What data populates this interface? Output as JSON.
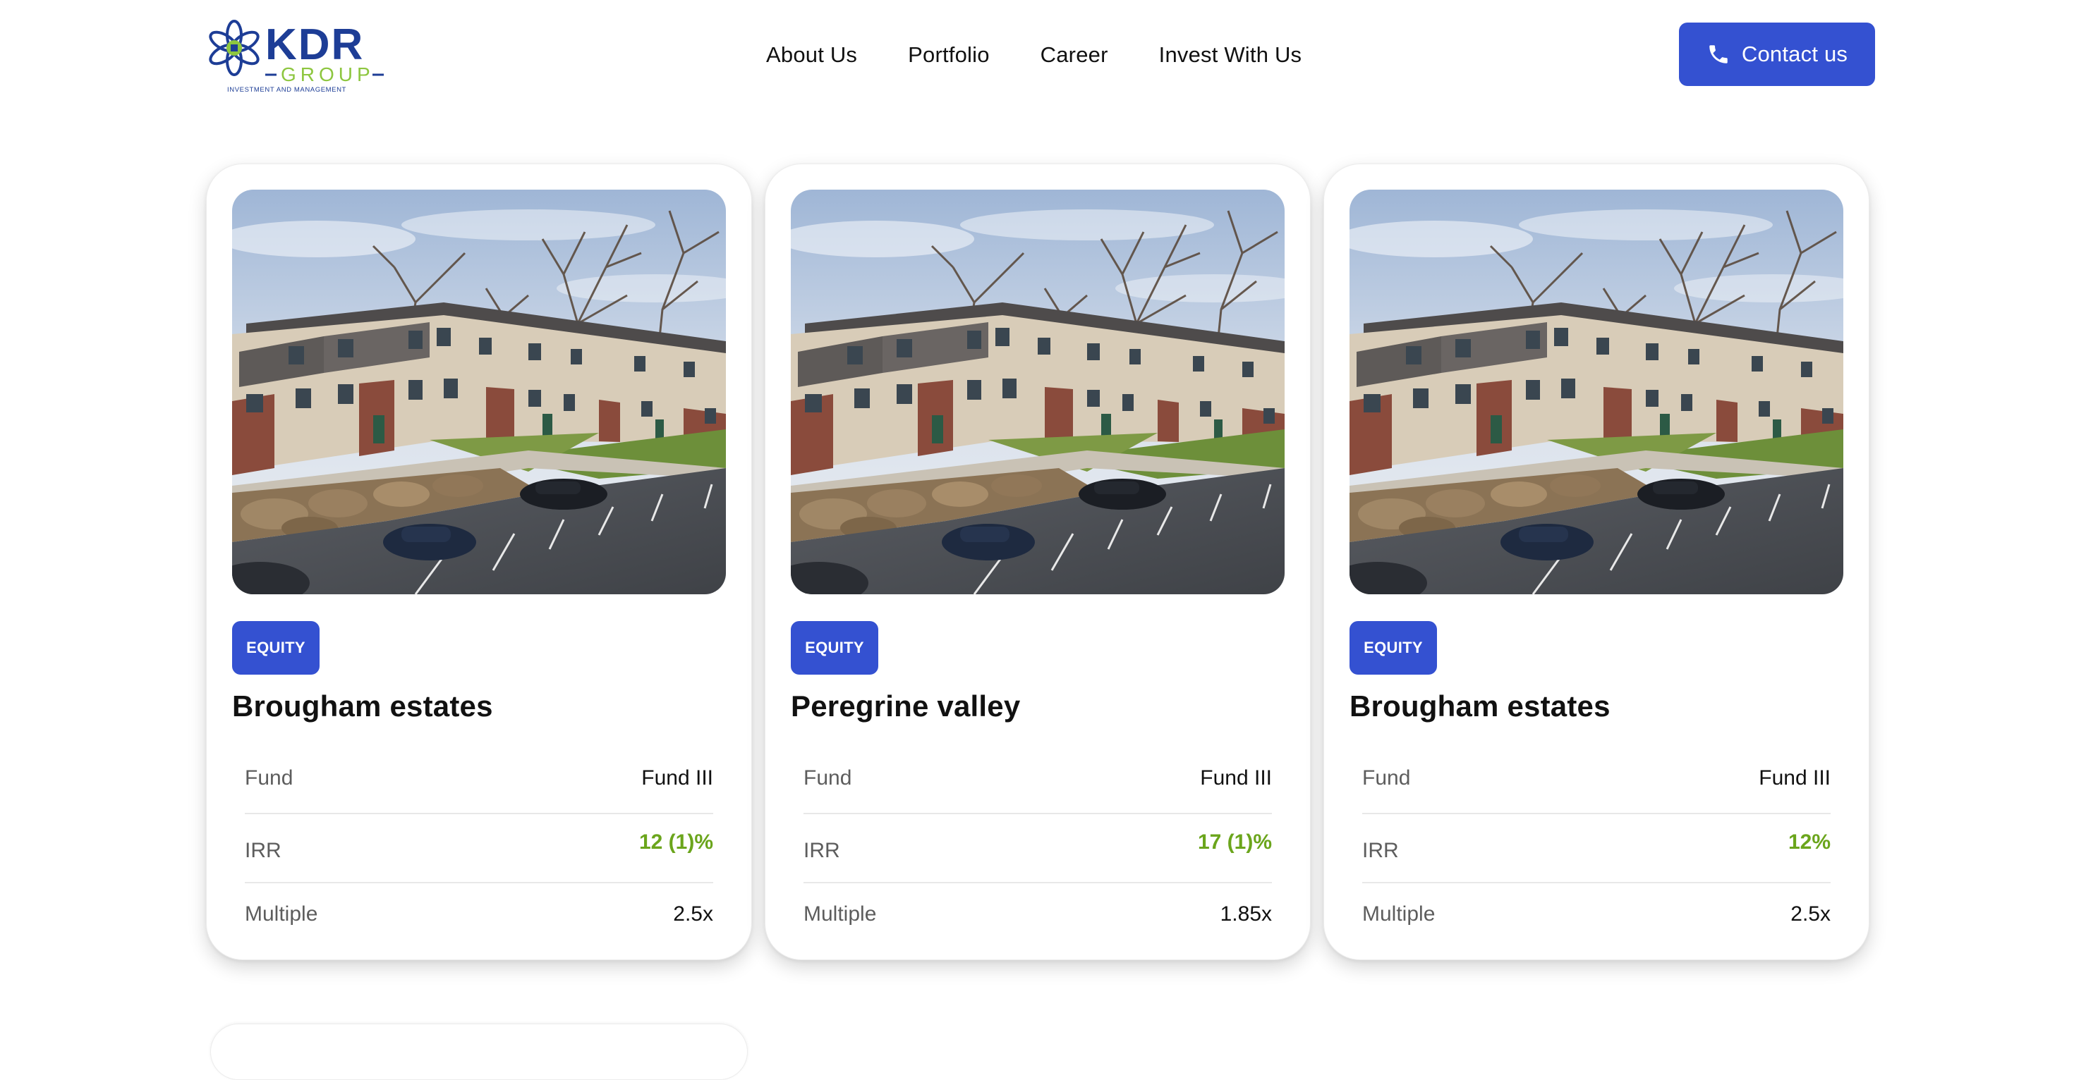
{
  "header": {
    "logo": {
      "text": "KDR",
      "sub": "GROUP",
      "tagline": "INVESTMENT AND MANAGEMENT",
      "icon": "star-flower-logo-icon"
    },
    "nav": [
      {
        "label": "About Us"
      },
      {
        "label": "Portfolio"
      },
      {
        "label": "Career"
      },
      {
        "label": "Invest With Us"
      }
    ],
    "contact": {
      "label": "Contact us",
      "icon": "phone-icon"
    }
  },
  "colors": {
    "accent": "#3451d1",
    "green": "#6ba51c",
    "logo_blue": "#1d3d96",
    "logo_green": "#8dc63f"
  },
  "cards": [
    {
      "badge": "EQUITY",
      "title": "Brougham estates",
      "stats": [
        {
          "label": "Fund",
          "value": "Fund III"
        },
        {
          "label": "IRR",
          "value": "12 (1)%"
        },
        {
          "label": "Multiple",
          "value": "2.5x"
        }
      ]
    },
    {
      "badge": "EQUITY",
      "title": "Peregrine valley",
      "stats": [
        {
          "label": "Fund",
          "value": "Fund III"
        },
        {
          "label": "IRR",
          "value": "17 (1)%"
        },
        {
          "label": "Multiple",
          "value": "1.85x"
        }
      ]
    },
    {
      "badge": "EQUITY",
      "title": "Brougham estates",
      "stats": [
        {
          "label": "Fund",
          "value": "Fund III"
        },
        {
          "label": "IRR",
          "value": "12%"
        },
        {
          "label": "Multiple",
          "value": "2.5x"
        }
      ]
    }
  ]
}
